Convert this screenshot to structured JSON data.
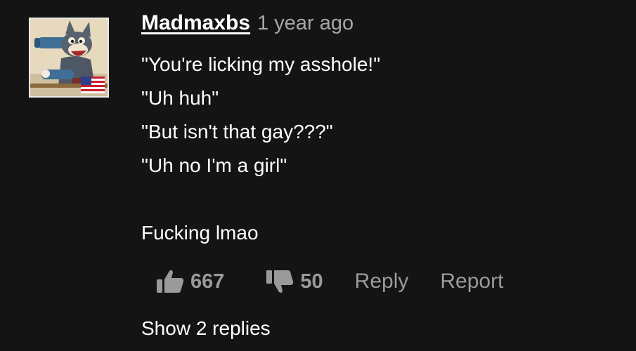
{
  "comment": {
    "username": "Madmaxbs",
    "timestamp": "1 year ago",
    "lines": [
      "\"You're licking my asshole!\"",
      "\"Uh huh\"",
      "\"But isn't that gay???\"",
      "\"Uh no I'm a girl\"",
      "",
      "Fucking lmao"
    ],
    "avatar_icon": "cartoon-cat-avatar",
    "flag_icon": "us-flag-icon"
  },
  "actions": {
    "likes": "667",
    "dislikes": "50",
    "reply_label": "Reply",
    "report_label": "Report"
  },
  "replies": {
    "show_label": "Show 2 replies"
  },
  "colors": {
    "background": "#151415",
    "text": "#ffffff",
    "muted": "#9a9a9a",
    "timestamp": "#a7a7a7"
  }
}
